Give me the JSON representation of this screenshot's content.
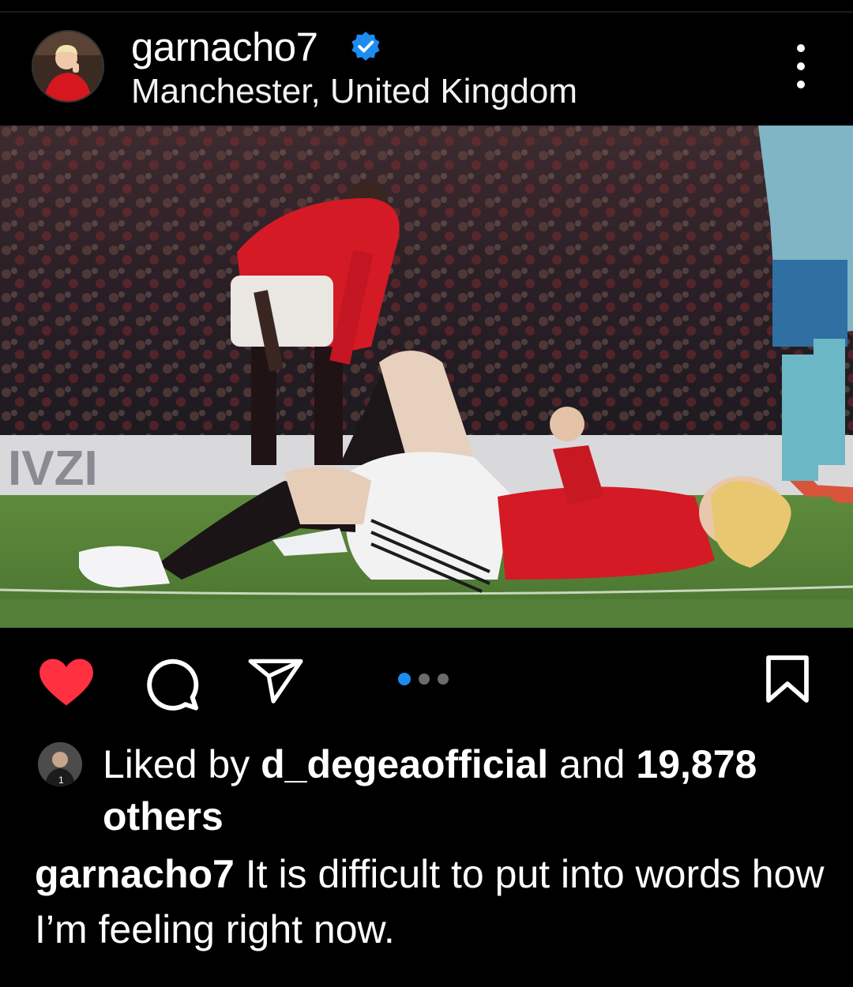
{
  "post": {
    "username": "garnacho7",
    "verified": true,
    "location": "Manchester, United Kingdom",
    "colors": {
      "verified_blue": "#1d8cf0",
      "like_red": "#ff3040",
      "page_bg": "#000000"
    }
  },
  "icons": {
    "more": "more-vertical-icon",
    "like": "heart-icon",
    "comment": "comment-icon",
    "share": "paper-plane-icon",
    "save": "bookmark-icon",
    "verified": "verified-badge-icon"
  },
  "carousel": {
    "current": 1,
    "total": 3
  },
  "likes": {
    "prefix": "Liked by",
    "liked_by_user": "d_degeaofficial",
    "connector": "and",
    "count": "19,878",
    "suffix": "others"
  },
  "caption": {
    "username": "garnacho7",
    "text": "It is difficult to put into words how I’m feeling right now."
  }
}
